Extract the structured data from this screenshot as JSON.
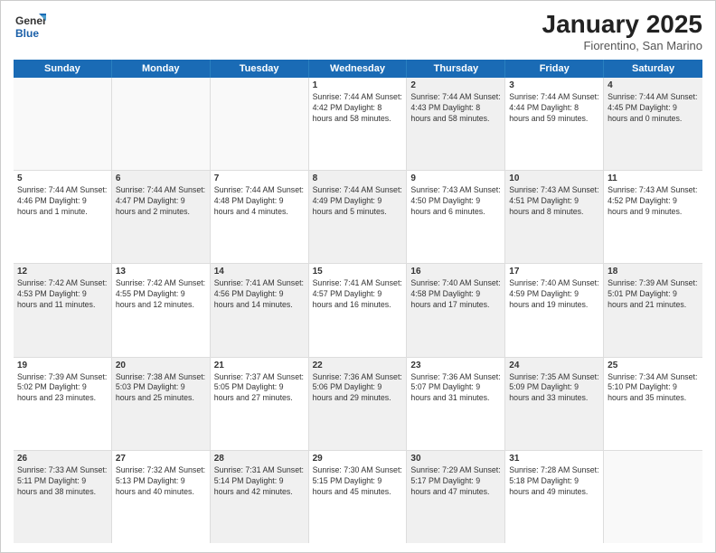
{
  "header": {
    "logo_general": "General",
    "logo_blue": "Blue",
    "month": "January 2025",
    "location": "Fiorentino, San Marino"
  },
  "weekdays": [
    "Sunday",
    "Monday",
    "Tuesday",
    "Wednesday",
    "Thursday",
    "Friday",
    "Saturday"
  ],
  "rows": [
    [
      {
        "day": "",
        "text": "",
        "shaded": true,
        "empty": true
      },
      {
        "day": "",
        "text": "",
        "shaded": true,
        "empty": true
      },
      {
        "day": "",
        "text": "",
        "shaded": true,
        "empty": true
      },
      {
        "day": "1",
        "text": "Sunrise: 7:44 AM\nSunset: 4:42 PM\nDaylight: 8 hours and 58 minutes.",
        "shaded": false
      },
      {
        "day": "2",
        "text": "Sunrise: 7:44 AM\nSunset: 4:43 PM\nDaylight: 8 hours and 58 minutes.",
        "shaded": true
      },
      {
        "day": "3",
        "text": "Sunrise: 7:44 AM\nSunset: 4:44 PM\nDaylight: 8 hours and 59 minutes.",
        "shaded": false
      },
      {
        "day": "4",
        "text": "Sunrise: 7:44 AM\nSunset: 4:45 PM\nDaylight: 9 hours and 0 minutes.",
        "shaded": true
      }
    ],
    [
      {
        "day": "5",
        "text": "Sunrise: 7:44 AM\nSunset: 4:46 PM\nDaylight: 9 hours and 1 minute.",
        "shaded": false
      },
      {
        "day": "6",
        "text": "Sunrise: 7:44 AM\nSunset: 4:47 PM\nDaylight: 9 hours and 2 minutes.",
        "shaded": true
      },
      {
        "day": "7",
        "text": "Sunrise: 7:44 AM\nSunset: 4:48 PM\nDaylight: 9 hours and 4 minutes.",
        "shaded": false
      },
      {
        "day": "8",
        "text": "Sunrise: 7:44 AM\nSunset: 4:49 PM\nDaylight: 9 hours and 5 minutes.",
        "shaded": true
      },
      {
        "day": "9",
        "text": "Sunrise: 7:43 AM\nSunset: 4:50 PM\nDaylight: 9 hours and 6 minutes.",
        "shaded": false
      },
      {
        "day": "10",
        "text": "Sunrise: 7:43 AM\nSunset: 4:51 PM\nDaylight: 9 hours and 8 minutes.",
        "shaded": true
      },
      {
        "day": "11",
        "text": "Sunrise: 7:43 AM\nSunset: 4:52 PM\nDaylight: 9 hours and 9 minutes.",
        "shaded": false
      }
    ],
    [
      {
        "day": "12",
        "text": "Sunrise: 7:42 AM\nSunset: 4:53 PM\nDaylight: 9 hours and 11 minutes.",
        "shaded": true
      },
      {
        "day": "13",
        "text": "Sunrise: 7:42 AM\nSunset: 4:55 PM\nDaylight: 9 hours and 12 minutes.",
        "shaded": false
      },
      {
        "day": "14",
        "text": "Sunrise: 7:41 AM\nSunset: 4:56 PM\nDaylight: 9 hours and 14 minutes.",
        "shaded": true
      },
      {
        "day": "15",
        "text": "Sunrise: 7:41 AM\nSunset: 4:57 PM\nDaylight: 9 hours and 16 minutes.",
        "shaded": false
      },
      {
        "day": "16",
        "text": "Sunrise: 7:40 AM\nSunset: 4:58 PM\nDaylight: 9 hours and 17 minutes.",
        "shaded": true
      },
      {
        "day": "17",
        "text": "Sunrise: 7:40 AM\nSunset: 4:59 PM\nDaylight: 9 hours and 19 minutes.",
        "shaded": false
      },
      {
        "day": "18",
        "text": "Sunrise: 7:39 AM\nSunset: 5:01 PM\nDaylight: 9 hours and 21 minutes.",
        "shaded": true
      }
    ],
    [
      {
        "day": "19",
        "text": "Sunrise: 7:39 AM\nSunset: 5:02 PM\nDaylight: 9 hours and 23 minutes.",
        "shaded": false
      },
      {
        "day": "20",
        "text": "Sunrise: 7:38 AM\nSunset: 5:03 PM\nDaylight: 9 hours and 25 minutes.",
        "shaded": true
      },
      {
        "day": "21",
        "text": "Sunrise: 7:37 AM\nSunset: 5:05 PM\nDaylight: 9 hours and 27 minutes.",
        "shaded": false
      },
      {
        "day": "22",
        "text": "Sunrise: 7:36 AM\nSunset: 5:06 PM\nDaylight: 9 hours and 29 minutes.",
        "shaded": true
      },
      {
        "day": "23",
        "text": "Sunrise: 7:36 AM\nSunset: 5:07 PM\nDaylight: 9 hours and 31 minutes.",
        "shaded": false
      },
      {
        "day": "24",
        "text": "Sunrise: 7:35 AM\nSunset: 5:09 PM\nDaylight: 9 hours and 33 minutes.",
        "shaded": true
      },
      {
        "day": "25",
        "text": "Sunrise: 7:34 AM\nSunset: 5:10 PM\nDaylight: 9 hours and 35 minutes.",
        "shaded": false
      }
    ],
    [
      {
        "day": "26",
        "text": "Sunrise: 7:33 AM\nSunset: 5:11 PM\nDaylight: 9 hours and 38 minutes.",
        "shaded": true
      },
      {
        "day": "27",
        "text": "Sunrise: 7:32 AM\nSunset: 5:13 PM\nDaylight: 9 hours and 40 minutes.",
        "shaded": false
      },
      {
        "day": "28",
        "text": "Sunrise: 7:31 AM\nSunset: 5:14 PM\nDaylight: 9 hours and 42 minutes.",
        "shaded": true
      },
      {
        "day": "29",
        "text": "Sunrise: 7:30 AM\nSunset: 5:15 PM\nDaylight: 9 hours and 45 minutes.",
        "shaded": false
      },
      {
        "day": "30",
        "text": "Sunrise: 7:29 AM\nSunset: 5:17 PM\nDaylight: 9 hours and 47 minutes.",
        "shaded": true
      },
      {
        "day": "31",
        "text": "Sunrise: 7:28 AM\nSunset: 5:18 PM\nDaylight: 9 hours and 49 minutes.",
        "shaded": false
      },
      {
        "day": "",
        "text": "",
        "shaded": true,
        "empty": true
      }
    ]
  ]
}
